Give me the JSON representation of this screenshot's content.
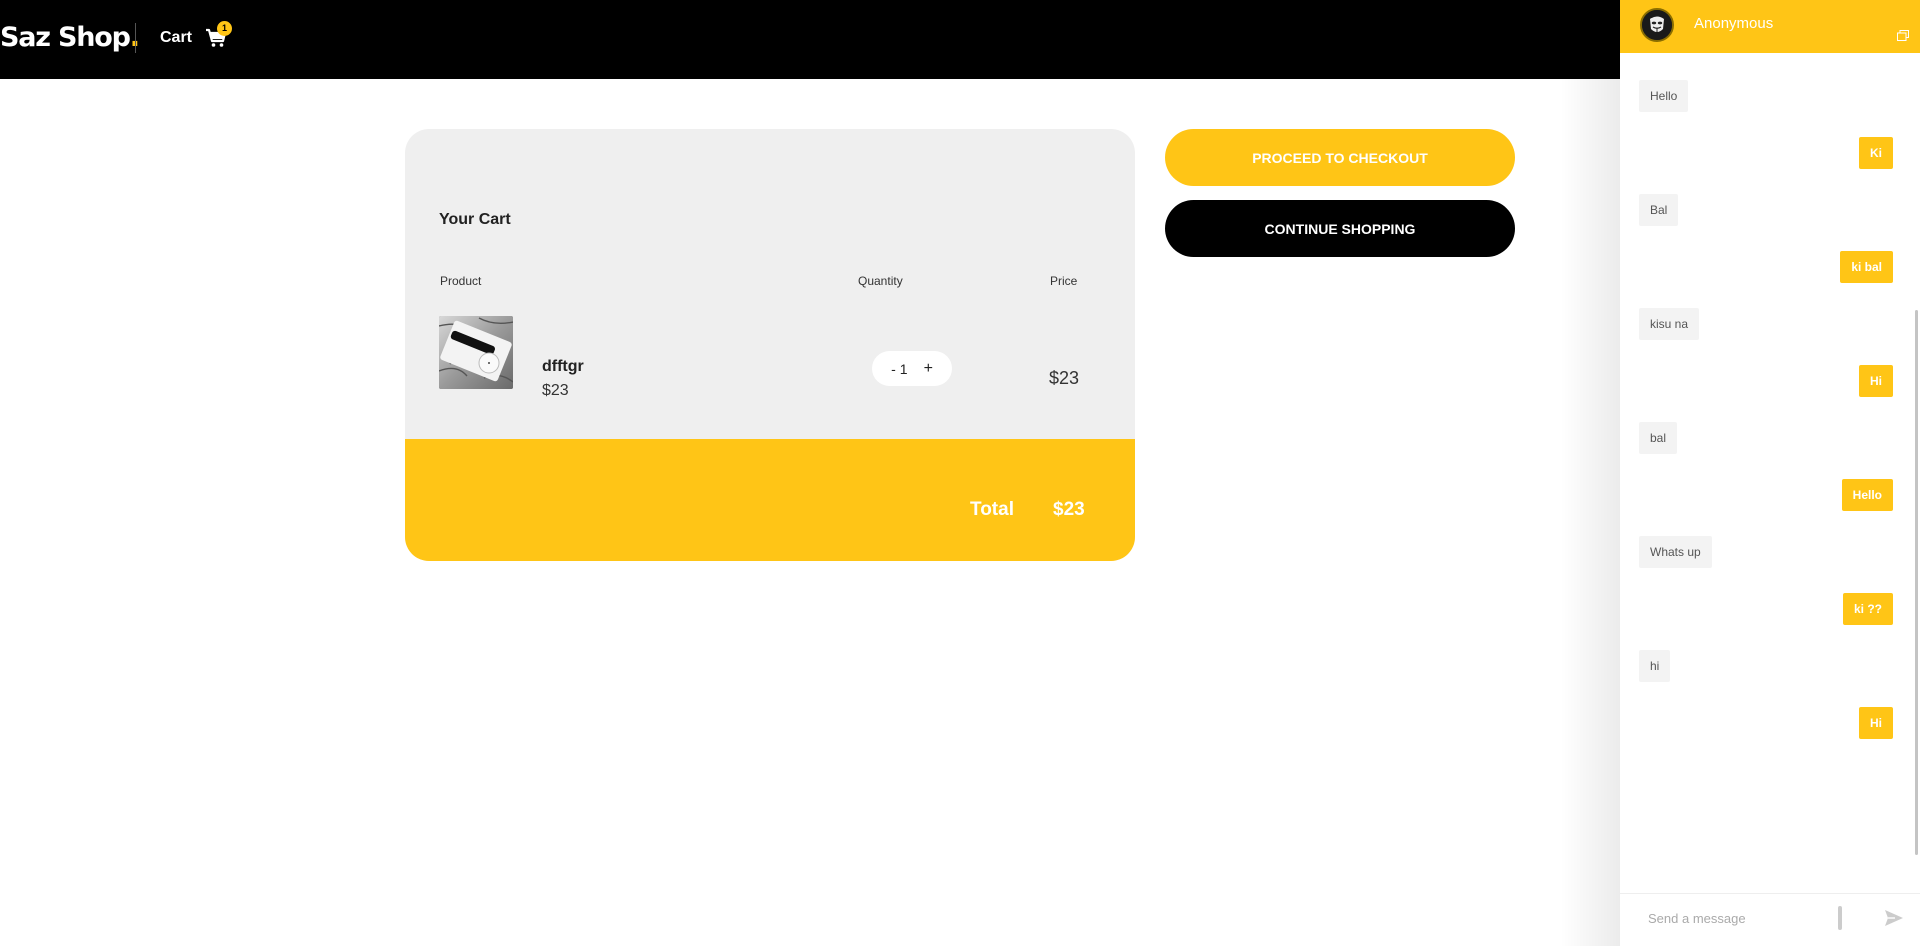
{
  "header": {
    "brand_name": "Saz Shop",
    "brand_dot": ".",
    "cart_label": "Cart",
    "cart_count": "1",
    "cart_icon": "cart-icon"
  },
  "cart": {
    "title": "Your Cart",
    "columns": {
      "product": "Product",
      "quantity": "Quantity",
      "price": "Price"
    },
    "items": [
      {
        "name": "dfftgr",
        "unit_price": "$23",
        "qty_minus": "-",
        "quantity": "1",
        "qty_plus": "+",
        "line_price": "$23",
        "image": "watch-product-image"
      }
    ],
    "total_label": "Total",
    "total_value": "$23"
  },
  "actions": {
    "checkout_label": "PROCEED TO CHECKOUT",
    "continue_label": "CONTINUE SHOPPING"
  },
  "chat": {
    "user_name": "Anonymous",
    "avatar_icon": "anonymous-mask-icon",
    "popout_icon": "popout-window-icon",
    "messages": [
      {
        "dir": "in",
        "text": "Hello"
      },
      {
        "dir": "out",
        "text": "Ki"
      },
      {
        "dir": "in",
        "text": "Bal"
      },
      {
        "dir": "out",
        "text": "ki bal"
      },
      {
        "dir": "in",
        "text": "kisu na"
      },
      {
        "dir": "out",
        "text": "Hi"
      },
      {
        "dir": "in",
        "text": "bal"
      },
      {
        "dir": "out",
        "text": "Hello"
      },
      {
        "dir": "in",
        "text": "Whats up"
      },
      {
        "dir": "out",
        "text": "ki ??"
      },
      {
        "dir": "in",
        "text": "hi"
      },
      {
        "dir": "out",
        "text": "Hi"
      }
    ],
    "input_placeholder": "Send a message",
    "send_icon": "send-icon"
  },
  "colors": {
    "accent": "#FFC516",
    "header_bg": "#000000",
    "card_bg": "#EFEFEF"
  }
}
